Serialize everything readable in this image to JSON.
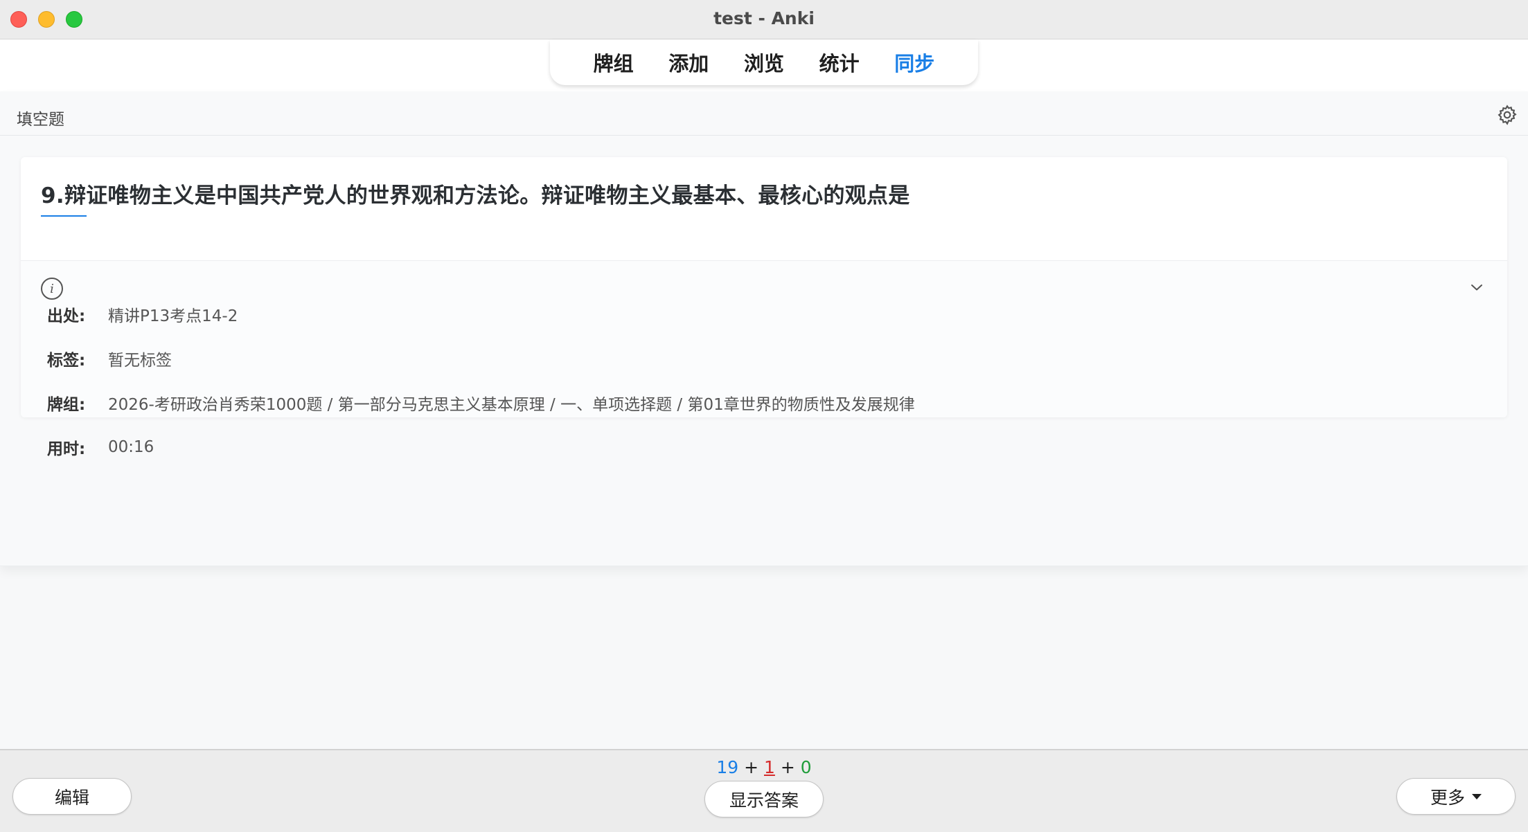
{
  "window": {
    "title": "test - Anki"
  },
  "nav": {
    "items": [
      {
        "label": "牌组",
        "active": false
      },
      {
        "label": "添加",
        "active": false
      },
      {
        "label": "浏览",
        "active": false
      },
      {
        "label": "统计",
        "active": false
      },
      {
        "label": "同步",
        "active": true
      }
    ]
  },
  "card": {
    "type_label": "填空题",
    "question": "9.辩证唯物主义是中国共产党人的世界观和方法论。辩证唯物主义最基本、最核心的观点是",
    "info": {
      "source": {
        "label": "出处:",
        "value": "精讲P13考点14-2"
      },
      "tags": {
        "label": "标签:",
        "value": "暂无标签"
      },
      "deck": {
        "label": "牌组:",
        "value": "2026-考研政治肖秀荣1000题 / 第一部分马克思主义基本原理 / 一、单项选择题 / 第01章世界的物质性及发展规律"
      },
      "time": {
        "label": "用时:",
        "value": "00:16"
      }
    }
  },
  "bottom": {
    "edit_label": "编辑",
    "show_answer_label": "显示答案",
    "more_label": "更多",
    "counts": {
      "new": "19",
      "learning": "1",
      "review": "0",
      "sep": "+"
    }
  },
  "colors": {
    "accent": "#1a7fe6",
    "learning": "#d52b2b",
    "review": "#1f9d3a"
  },
  "icons": {
    "settings": "gear-icon",
    "info": "info-icon",
    "expand": "chevron-down-icon",
    "more_caret": "caret-down-icon"
  }
}
